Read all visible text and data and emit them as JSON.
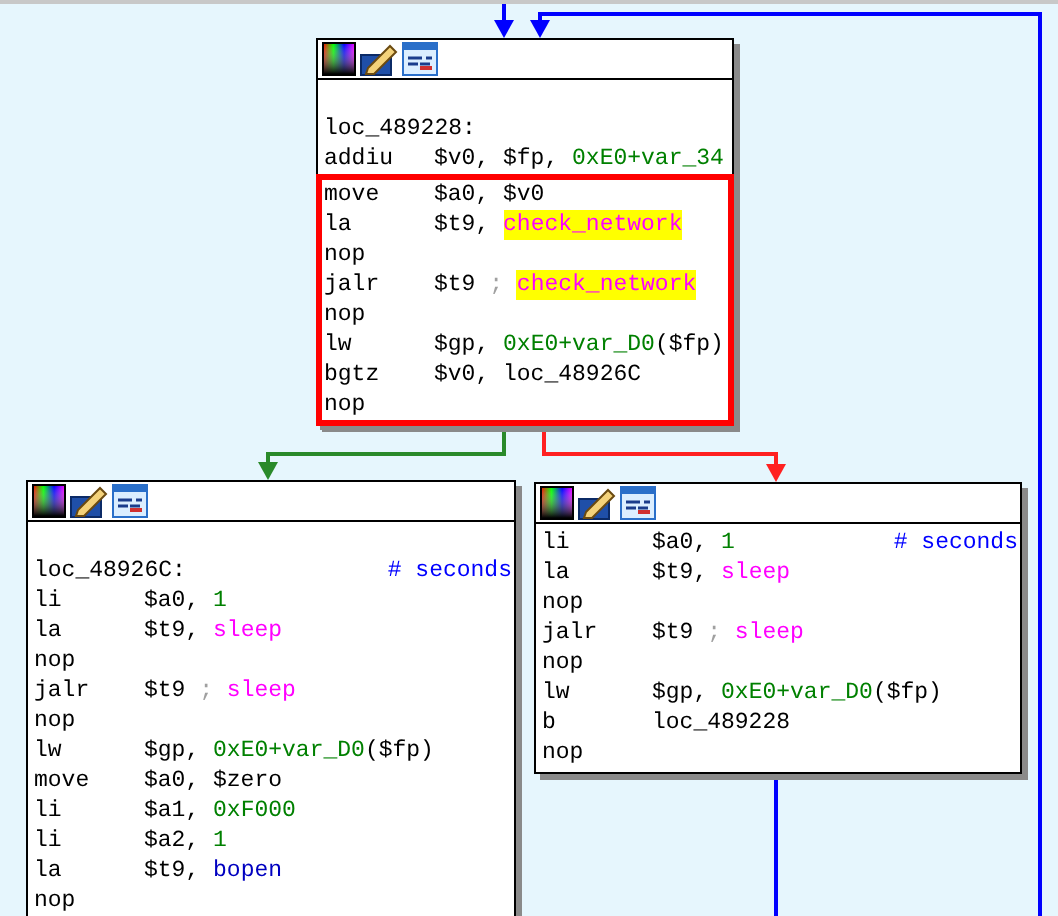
{
  "nodes": [
    {
      "kind": "top",
      "leading_blank": true,
      "blocks": [
        {
          "selected": false,
          "lines": [
            {
              "kind": "label",
              "label": "loc_489228:"
            },
            {
              "kind": "insn",
              "mnemonic": "addiu",
              "operands": [
                {
                  "text": "$v0, $fp, ",
                  "kind": "plain"
                },
                {
                  "text": "0xE0+var_34",
                  "kind": "number"
                }
              ]
            }
          ]
        },
        {
          "selected": true,
          "lines": [
            {
              "kind": "insn",
              "mnemonic": "move",
              "operands": [
                {
                  "text": "$a0, $v0",
                  "kind": "plain"
                }
              ]
            },
            {
              "kind": "insn",
              "mnemonic": "la",
              "operands": [
                {
                  "text": "$t9, ",
                  "kind": "plain"
                },
                {
                  "text": "check_network",
                  "kind": "name",
                  "highlighted": true
                }
              ]
            },
            {
              "kind": "insn",
              "mnemonic": "nop"
            },
            {
              "kind": "insn",
              "mnemonic": "jalr",
              "operands": [
                {
                  "text": "$t9 ",
                  "kind": "plain"
                },
                {
                  "text": "; ",
                  "kind": "separator"
                },
                {
                  "text": "check_network",
                  "kind": "name",
                  "highlighted": true
                }
              ]
            },
            {
              "kind": "insn",
              "mnemonic": "nop"
            },
            {
              "kind": "insn",
              "mnemonic": "lw",
              "operands": [
                {
                  "text": "$gp, ",
                  "kind": "plain"
                },
                {
                  "text": "0xE0+var_D0",
                  "kind": "number"
                },
                {
                  "text": "($fp)",
                  "kind": "plain"
                }
              ]
            },
            {
              "kind": "insn",
              "mnemonic": "bgtz",
              "operands": [
                {
                  "text": "$v0, loc_48926C",
                  "kind": "plain"
                }
              ]
            },
            {
              "kind": "insn",
              "mnemonic": "nop"
            }
          ]
        }
      ]
    },
    {
      "kind": "left",
      "leading_blank": true,
      "blocks": [
        {
          "selected": false,
          "lines": [
            {
              "kind": "label",
              "label": "loc_48926C:",
              "comment": "# seconds"
            },
            {
              "kind": "insn",
              "mnemonic": "li",
              "operands": [
                {
                  "text": "$a0, ",
                  "kind": "plain"
                },
                {
                  "text": "1",
                  "kind": "number"
                }
              ]
            },
            {
              "kind": "insn",
              "mnemonic": "la",
              "operands": [
                {
                  "text": "$t9, ",
                  "kind": "plain"
                },
                {
                  "text": "sleep",
                  "kind": "name",
                  "highlighted": false
                }
              ]
            },
            {
              "kind": "insn",
              "mnemonic": "nop"
            },
            {
              "kind": "insn",
              "mnemonic": "jalr",
              "operands": [
                {
                  "text": "$t9 ",
                  "kind": "plain"
                },
                {
                  "text": "; ",
                  "kind": "separator"
                },
                {
                  "text": "sleep",
                  "kind": "name",
                  "highlighted": false
                }
              ]
            },
            {
              "kind": "insn",
              "mnemonic": "nop"
            },
            {
              "kind": "insn",
              "mnemonic": "lw",
              "operands": [
                {
                  "text": "$gp, ",
                  "kind": "plain"
                },
                {
                  "text": "0xE0+var_D0",
                  "kind": "number"
                },
                {
                  "text": "($fp)",
                  "kind": "plain"
                }
              ]
            },
            {
              "kind": "insn",
              "mnemonic": "move",
              "operands": [
                {
                  "text": "$a0, $zero",
                  "kind": "plain"
                }
              ]
            },
            {
              "kind": "insn",
              "mnemonic": "li",
              "operands": [
                {
                  "text": "$a1, ",
                  "kind": "plain"
                },
                {
                  "text": "0xF000",
                  "kind": "number"
                }
              ]
            },
            {
              "kind": "insn",
              "mnemonic": "li",
              "operands": [
                {
                  "text": "$a2, ",
                  "kind": "plain"
                },
                {
                  "text": "1",
                  "kind": "number"
                }
              ]
            },
            {
              "kind": "insn",
              "mnemonic": "la",
              "operands": [
                {
                  "text": "$t9, ",
                  "kind": "plain"
                },
                {
                  "text": "bopen",
                  "kind": "import"
                }
              ]
            },
            {
              "kind": "insn",
              "mnemonic": "nop"
            }
          ]
        }
      ]
    },
    {
      "kind": "right",
      "leading_blank": false,
      "blocks": [
        {
          "selected": false,
          "lines": [
            {
              "kind": "insn",
              "mnemonic": "li",
              "operands": [
                {
                  "text": "$a0, ",
                  "kind": "plain"
                },
                {
                  "text": "1",
                  "kind": "number"
                }
              ],
              "comment": "# seconds"
            },
            {
              "kind": "insn",
              "mnemonic": "la",
              "operands": [
                {
                  "text": "$t9, ",
                  "kind": "plain"
                },
                {
                  "text": "sleep",
                  "kind": "name",
                  "highlighted": false
                }
              ]
            },
            {
              "kind": "insn",
              "mnemonic": "nop"
            },
            {
              "kind": "insn",
              "mnemonic": "jalr",
              "operands": [
                {
                  "text": "$t9 ",
                  "kind": "plain"
                },
                {
                  "text": "; ",
                  "kind": "separator"
                },
                {
                  "text": "sleep",
                  "kind": "name",
                  "highlighted": false
                }
              ]
            },
            {
              "kind": "insn",
              "mnemonic": "nop"
            },
            {
              "kind": "insn",
              "mnemonic": "lw",
              "operands": [
                {
                  "text": "$gp, ",
                  "kind": "plain"
                },
                {
                  "text": "0xE0+var_D0",
                  "kind": "number"
                },
                {
                  "text": "($fp)",
                  "kind": "plain"
                }
              ]
            },
            {
              "kind": "insn",
              "mnemonic": "b",
              "operands": [
                {
                  "text": "loc_489228",
                  "kind": "plain"
                }
              ]
            },
            {
              "kind": "insn",
              "mnemonic": "nop"
            }
          ]
        }
      ]
    }
  ],
  "edges": [
    {
      "kind": "entry"
    },
    {
      "kind": "loop"
    },
    {
      "kind": "true"
    },
    {
      "kind": "false"
    },
    {
      "kind": "down"
    }
  ]
}
